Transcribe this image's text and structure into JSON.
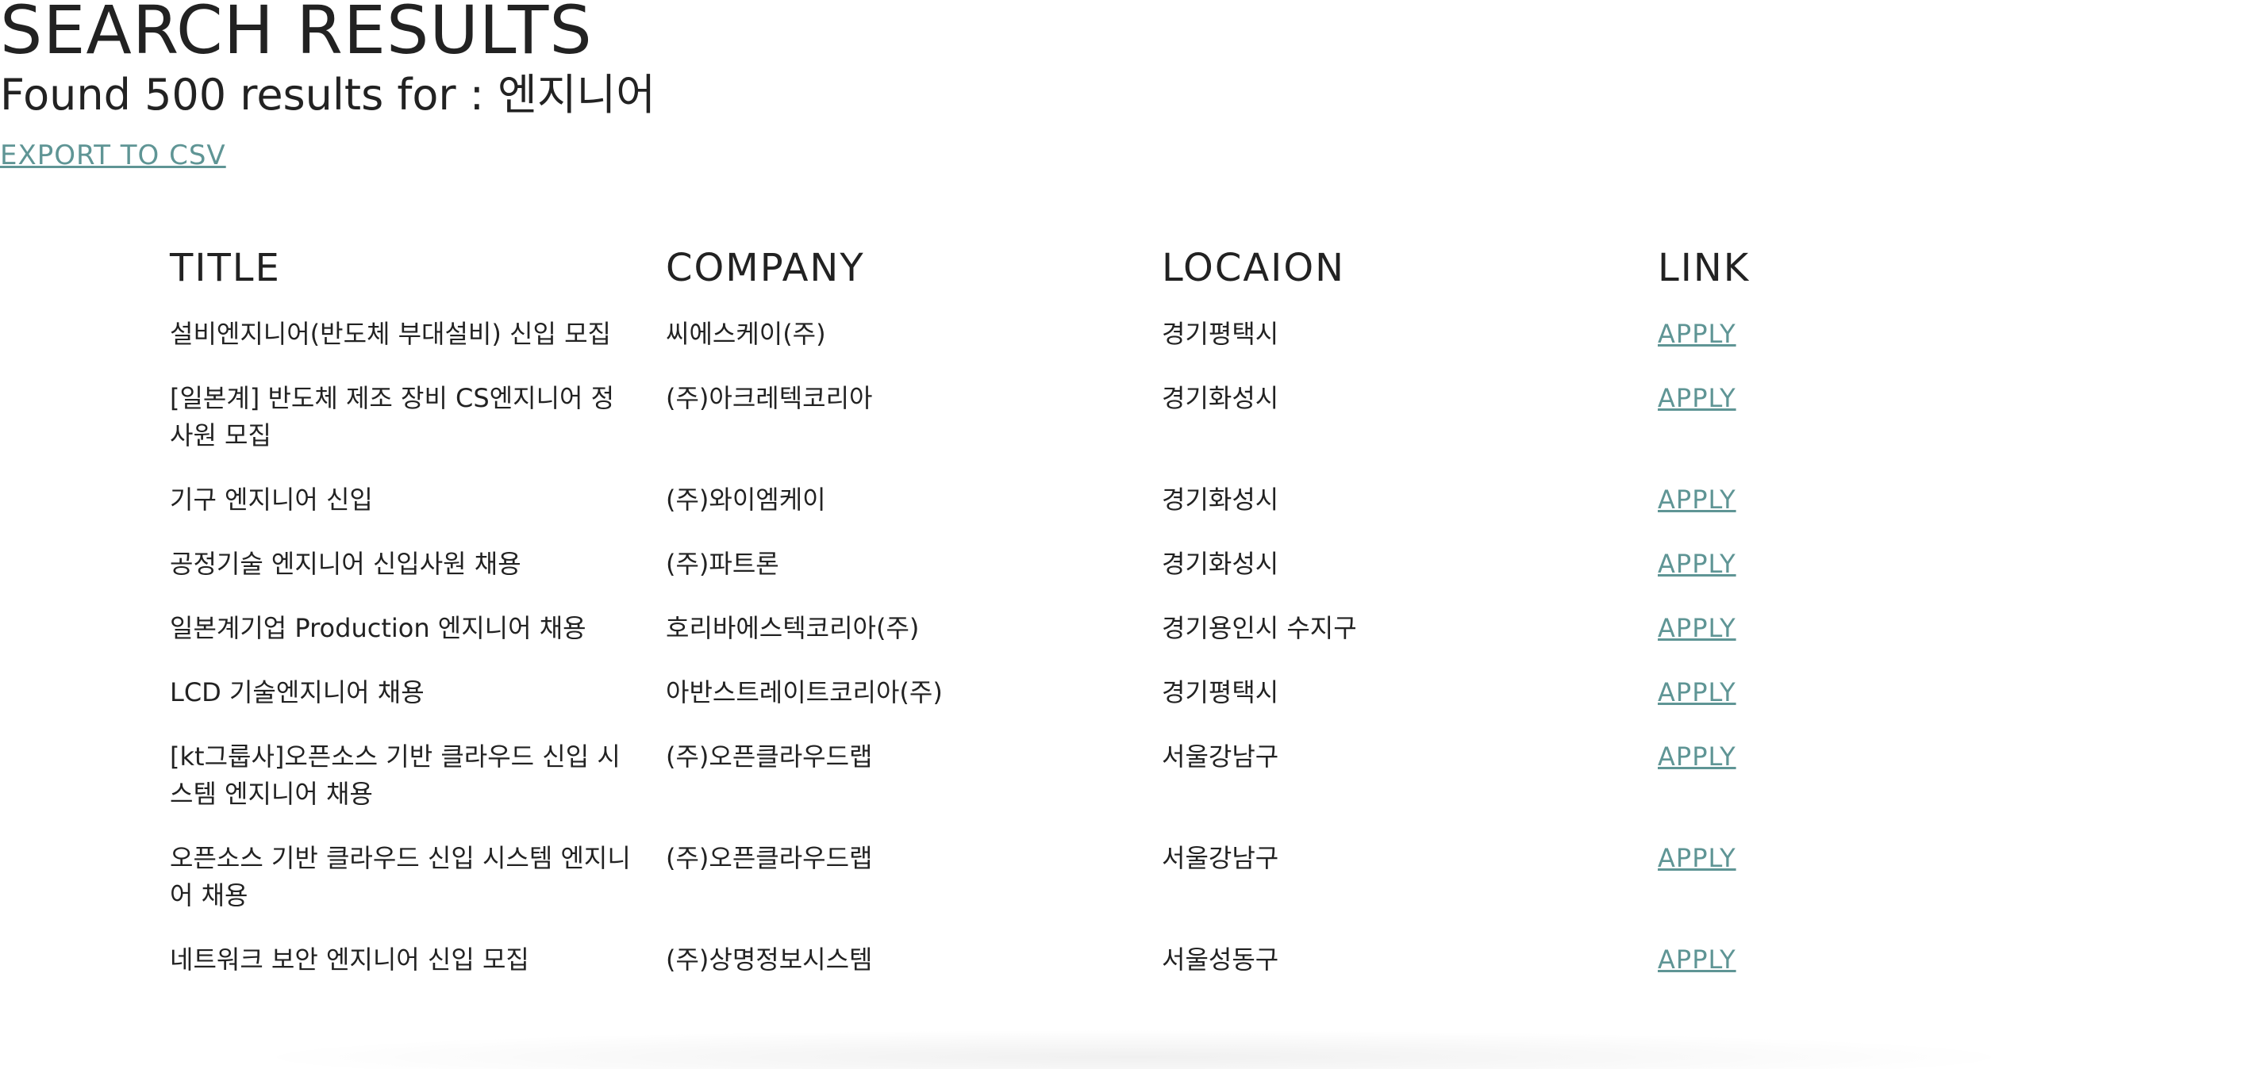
{
  "header": {
    "title": "SEARCH RESULTS",
    "summary_prefix": "Found 500 results for : ",
    "query": "엔지니어",
    "export_label": "EXPORT TO CSV"
  },
  "table": {
    "columns": [
      "TITLE",
      "COMPANY",
      "LOCAION",
      "LINK"
    ],
    "rows": [
      {
        "title": "설비엔지니어(반도체 부대설비) 신입 모집",
        "company": "씨에스케이(주)",
        "location": "경기평택시",
        "link": "APPLY"
      },
      {
        "title": "[일본계] 반도체 제조 장비 CS엔지니어 정사원 모집",
        "company": "(주)아크레텍코리아",
        "location": "경기화성시",
        "link": "APPLY"
      },
      {
        "title": "기구 엔지니어 신입",
        "company": "(주)와이엠케이",
        "location": "경기화성시",
        "link": "APPLY"
      },
      {
        "title": "공정기술 엔지니어 신입사원 채용",
        "company": "(주)파트론",
        "location": "경기화성시",
        "link": "APPLY"
      },
      {
        "title": "일본계기업 Production 엔지니어 채용",
        "company": "호리바에스텍코리아(주)",
        "location": "경기용인시 수지구",
        "link": "APPLY"
      },
      {
        "title": "LCD 기술엔지니어 채용",
        "company": "아반스트레이트코리아(주)",
        "location": "경기평택시",
        "link": "APPLY"
      },
      {
        "title": "[kt그룹사]오픈소스 기반 클라우드 신입 시스템 엔지니어 채용",
        "company": "(주)오픈클라우드랩",
        "location": "서울강남구",
        "link": "APPLY"
      },
      {
        "title": "오픈소스 기반 클라우드 신입 시스템 엔지니어 채용",
        "company": "(주)오픈클라우드랩",
        "location": "서울강남구",
        "link": "APPLY"
      },
      {
        "title": "네트워크 보안 엔지니어 신입 모집",
        "company": "(주)상명정보시스템",
        "location": "서울성동구",
        "link": "APPLY"
      }
    ]
  },
  "colors": {
    "link": "#5f9595",
    "text": "#222222",
    "background": "#ffffff"
  }
}
